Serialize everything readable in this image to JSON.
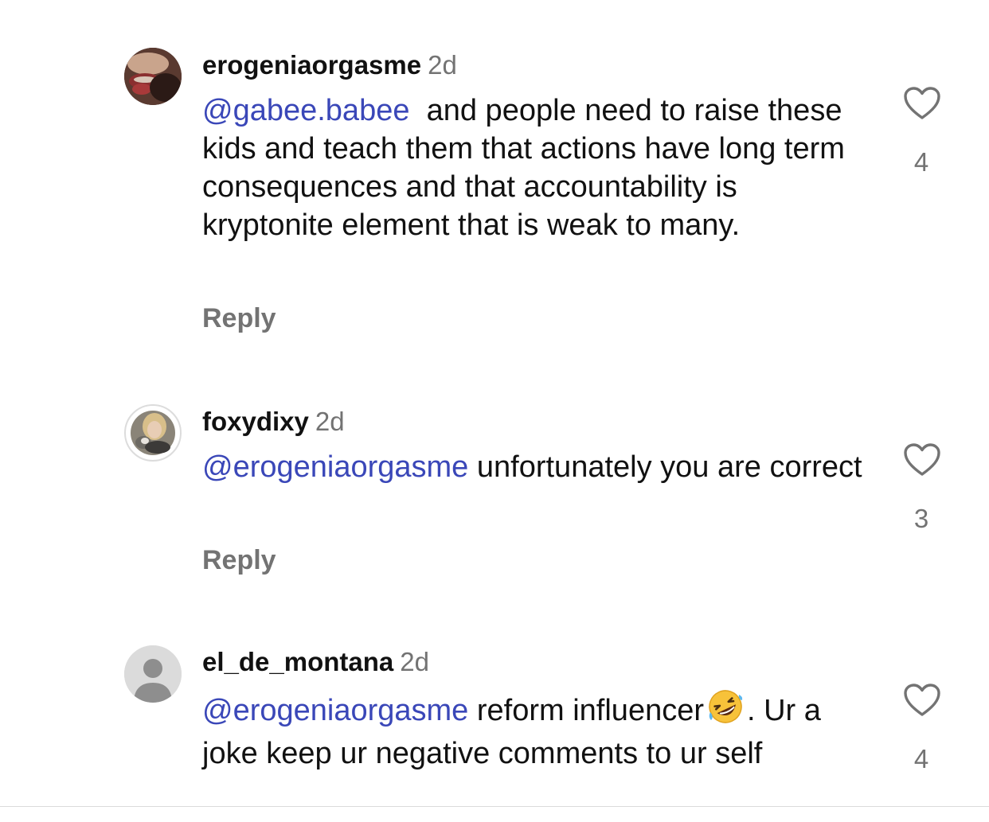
{
  "comments": [
    {
      "username": "erogeniaorgasme",
      "time": "2d",
      "mention": "@gabee.babee",
      "text": "  and people need to raise these kids and teach them that actions have long term consequences and that accountability is kryptonite element that is weak to many.",
      "reply_label": "Reply",
      "likes": "4",
      "avatar": "profile-photo-lips"
    },
    {
      "username": "foxydixy",
      "time": "2d",
      "mention": "@erogeniaorgasme",
      "text": " unfortunately you are correct",
      "reply_label": "Reply",
      "likes": "3",
      "avatar": "profile-photo-woman-blonde"
    },
    {
      "username": "el_de_montana",
      "time": "2d",
      "mention": "@erogeniaorgasme",
      "text_before_emoji": " reform influencer",
      "emoji": "rolling-on-floor-laughing-emoji",
      "text_after_emoji": ". Ur a joke keep ur negative comments to ur self",
      "likes": "4",
      "avatar": "default-avatar-icon"
    }
  ],
  "colors": {
    "mention": "#3a47b8",
    "secondary": "#737373",
    "text": "#111111"
  }
}
